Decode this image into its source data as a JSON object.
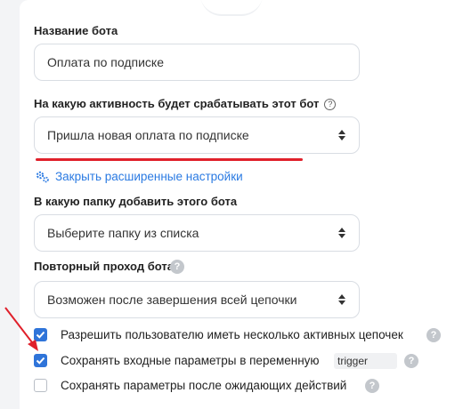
{
  "bot_name": {
    "label": "Название бота",
    "value": "Оплата по подписке"
  },
  "activity": {
    "label": "На какую активность будет срабатывать этот бот",
    "help": "?",
    "value": "Пришла новая оплата по подписке"
  },
  "advanced_link": "Закрыть расширенные настройки",
  "folder": {
    "label": "В какую папку добавить этого бота",
    "placeholder": "Выберите папку из списка"
  },
  "repeat": {
    "label": "Повторный проход бота",
    "help": "?",
    "value": "Возможен после завершения всей цепочки"
  },
  "options": [
    {
      "label": "Разрешить пользователю иметь несколько активных цепочек",
      "checked": true,
      "help": "?"
    },
    {
      "label": "Сохранять входные параметры в переменную",
      "checked": true,
      "variable": "trigger",
      "help": "?"
    },
    {
      "label": "Сохранять параметры после ожидающих действий",
      "checked": false,
      "help": "?"
    }
  ],
  "colors": {
    "accent": "#2a7ae2",
    "checkbox": "#2f74d9",
    "annotation": "#e0202b"
  }
}
